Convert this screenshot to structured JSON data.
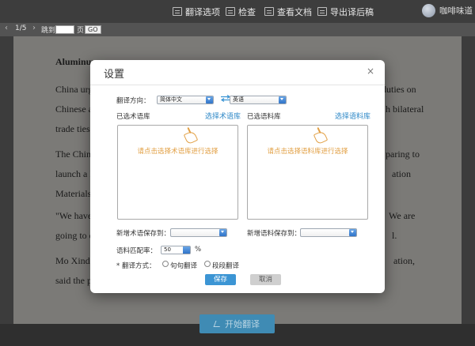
{
  "topbar": {
    "nav": [
      {
        "label": "翻译选项",
        "icon": "translate-options-icon"
      },
      {
        "label": "检查",
        "icon": "check-icon"
      },
      {
        "label": "查看文档",
        "icon": "view-document-icon"
      },
      {
        "label": "导出译后稿",
        "icon": "export-icon"
      }
    ],
    "user_name": "咖啡味道"
  },
  "pagebar": {
    "page_indicator": "1/5",
    "goto_label": "跳到",
    "page_unit": "页",
    "go_label": "GO"
  },
  "document": {
    "lines": [
      {
        "text": "Aluminum",
        "bold": true
      },
      {
        "text": "China urge",
        "bold": false
      },
      {
        "text": "duties on",
        "bold": false
      },
      {
        "text": "Chinese al",
        "bold": false
      },
      {
        "text": "h bilateral",
        "bold": false
      },
      {
        "text": "trade ties,",
        "bold": false
      },
      {
        "text": "The China",
        "bold": false
      },
      {
        "text": "paring to",
        "bold": false
      },
      {
        "text": "launch a le",
        "bold": false
      },
      {
        "text": "ation",
        "bold": false
      },
      {
        "text": "Materials",
        "bold": false
      },
      {
        "text": "\"We have",
        "bold": false
      },
      {
        "text": "We are",
        "bold": false
      },
      {
        "text": "going to e",
        "bold": false
      },
      {
        "text": "l.",
        "bold": false
      },
      {
        "text": "Mo Xinda",
        "bold": false
      },
      {
        "text": "ation,",
        "bold": false
      },
      {
        "text": "said the pr",
        "bold": false
      }
    ]
  },
  "start_button": {
    "label": "开始翻译",
    "icon": "pen-icon"
  },
  "modal": {
    "title": "设置",
    "close": "×",
    "direction_label": "翻译方向：",
    "source_lang": "简体中文",
    "target_lang": "英语",
    "term_db_label": "已选术语库",
    "term_db_link": "选择术语库",
    "corpus_label": "已选语料库",
    "corpus_link": "选择语料库",
    "term_hint": "请点击选择术语库进行选择",
    "corpus_hint": "请点击选择语料库进行选择",
    "save_term_label": "新增术语保存到：",
    "save_corpus_label": "新增语料保存到：",
    "match_label": "语料匹配率：",
    "match_value": "50",
    "match_unit": "%",
    "mode_label": "* 翻译方式：",
    "mode_options": [
      "句句翻译",
      "段段翻译"
    ],
    "save_btn": "保存",
    "cancel_btn": "取消"
  },
  "colors": {
    "accent": "#3c95d4",
    "link": "#2e88c7",
    "hint": "#e2a045"
  }
}
